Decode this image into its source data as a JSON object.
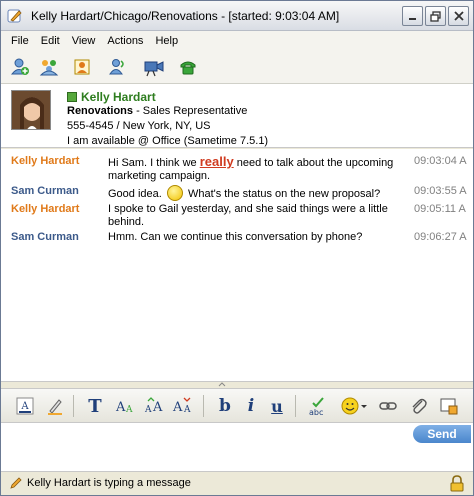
{
  "window": {
    "title": "Kelly Hardart/Chicago/Renovations - [started: 9:03:04 AM]"
  },
  "menu": [
    "File",
    "Edit",
    "View",
    "Actions",
    "Help"
  ],
  "toolbar_icons": [
    "add-person-icon",
    "group-icon",
    "invite-icon",
    "people-icon",
    "video-icon",
    "phone-icon"
  ],
  "card": {
    "name": "Kelly Hardart",
    "company": "Renovations",
    "role": " - Sales Representative",
    "phone": "555-4545 / New York, NY, US",
    "availability": "I am available @ Office (Sametime 7.5.1)",
    "status_color": "#56a83c"
  },
  "messages": [
    {
      "sender": "Kelly Hardart",
      "text_before": "Hi Sam. I think we ",
      "emphasis": "really",
      "text_after": " need to talk about the upcoming marketing campaign.",
      "time": "09:03:04 A"
    },
    {
      "sender": "Sam Curman",
      "text_before": "Good idea.",
      "text_after": "What's the status on the new proposal?",
      "time": "09:03:55 A"
    },
    {
      "sender": "Kelly Hardart",
      "text": "I spoke to Gail yesterday, and she said things were a little behind.",
      "time": "09:05:11 A"
    },
    {
      "sender": "Sam Curman",
      "text": "Hmm. Can we continue this conversation by phone?",
      "time": "09:06:27 A"
    }
  ],
  "format_toolbar": {
    "bold": "b",
    "italic": "i",
    "underline": "u",
    "font": "T"
  },
  "send_label": "Send",
  "status": {
    "typing": "Kelly Hardart is typing a message"
  },
  "colors": {
    "kelly": "#e07a1a",
    "sam": "#3c5a8a",
    "accent": "#4a86cc"
  }
}
